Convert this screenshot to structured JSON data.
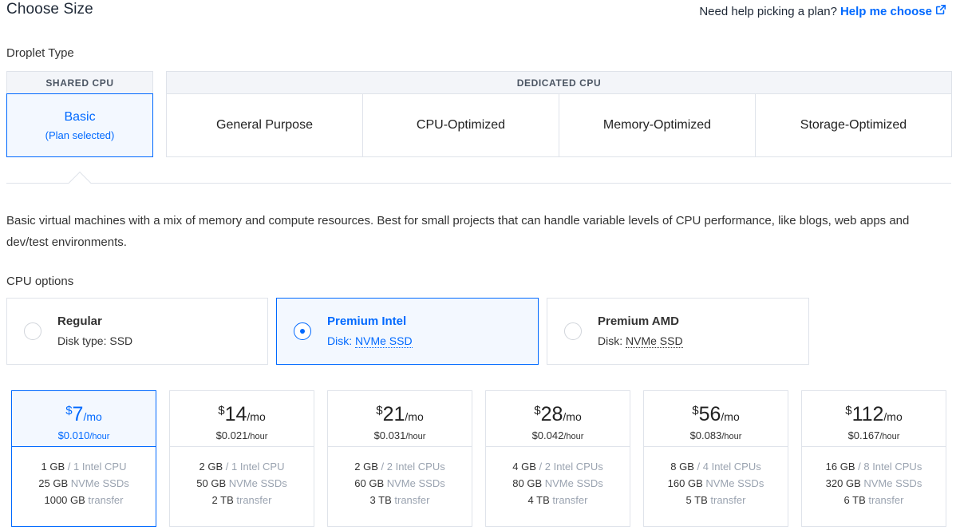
{
  "header": {
    "title": "Choose Size",
    "help_text": "Need help picking a plan?",
    "help_link": "Help me choose"
  },
  "droplet_type": {
    "label": "Droplet Type",
    "shared_heading": "SHARED CPU",
    "basic_name": "Basic",
    "basic_sub": "(Plan selected)",
    "dedicated_heading": "DEDICATED CPU",
    "dedicated_items": [
      "General Purpose",
      "CPU-Optimized",
      "Memory-Optimized",
      "Storage-Optimized"
    ]
  },
  "description": "Basic virtual machines with a mix of memory and compute resources. Best for small projects that can handle variable levels of CPU performance, like blogs, web apps and dev/test environments.",
  "cpu_options": {
    "label": "CPU options",
    "items": [
      {
        "name": "Regular",
        "disk_prefix": "Disk type: ",
        "disk_value": "SSD",
        "selected": false
      },
      {
        "name": "Premium Intel",
        "disk_prefix": "Disk: ",
        "disk_value": "NVMe SSD",
        "selected": true
      },
      {
        "name": "Premium AMD",
        "disk_prefix": "Disk: ",
        "disk_value": "NVMe SSD",
        "selected": false
      }
    ]
  },
  "plans": [
    {
      "currency": "$",
      "amount": "7",
      "per": "/mo",
      "hourly": "$0.010",
      "hour_unit": "/hour",
      "mem": "1 GB",
      "cpu": " / 1 Intel CPU",
      "disk": "25 GB",
      "disk_type": " NVMe SSDs",
      "transfer": "1000 GB",
      "transfer_label": " transfer",
      "selected": true
    },
    {
      "currency": "$",
      "amount": "14",
      "per": "/mo",
      "hourly": "$0.021",
      "hour_unit": "/hour",
      "mem": "2 GB",
      "cpu": " / 1 Intel CPU",
      "disk": "50 GB",
      "disk_type": " NVMe SSDs",
      "transfer": "2 TB",
      "transfer_label": " transfer",
      "selected": false
    },
    {
      "currency": "$",
      "amount": "21",
      "per": "/mo",
      "hourly": "$0.031",
      "hour_unit": "/hour",
      "mem": "2 GB",
      "cpu": " / 2 Intel CPUs",
      "disk": "60 GB",
      "disk_type": " NVMe SSDs",
      "transfer": "3 TB",
      "transfer_label": " transfer",
      "selected": false
    },
    {
      "currency": "$",
      "amount": "28",
      "per": "/mo",
      "hourly": "$0.042",
      "hour_unit": "/hour",
      "mem": "4 GB",
      "cpu": " / 2 Intel CPUs",
      "disk": "80 GB",
      "disk_type": " NVMe SSDs",
      "transfer": "4 TB",
      "transfer_label": " transfer",
      "selected": false
    },
    {
      "currency": "$",
      "amount": "56",
      "per": "/mo",
      "hourly": "$0.083",
      "hour_unit": "/hour",
      "mem": "8 GB",
      "cpu": " / 4 Intel CPUs",
      "disk": "160 GB",
      "disk_type": " NVMe SSDs",
      "transfer": "5 TB",
      "transfer_label": " transfer",
      "selected": false
    },
    {
      "currency": "$",
      "amount": "112",
      "per": "/mo",
      "hourly": "$0.167",
      "hour_unit": "/hour",
      "mem": "16 GB",
      "cpu": " / 8 Intel CPUs",
      "disk": "320 GB",
      "disk_type": " NVMe SSDs",
      "transfer": "6 TB",
      "transfer_label": " transfer",
      "selected": false
    }
  ],
  "colors": {
    "accent": "#0069ff",
    "selected_bg": "#f3f8ff",
    "border": "#dfe3ea",
    "muted": "#9aa3b0"
  },
  "icons": {
    "help_link": "external-link-icon"
  }
}
